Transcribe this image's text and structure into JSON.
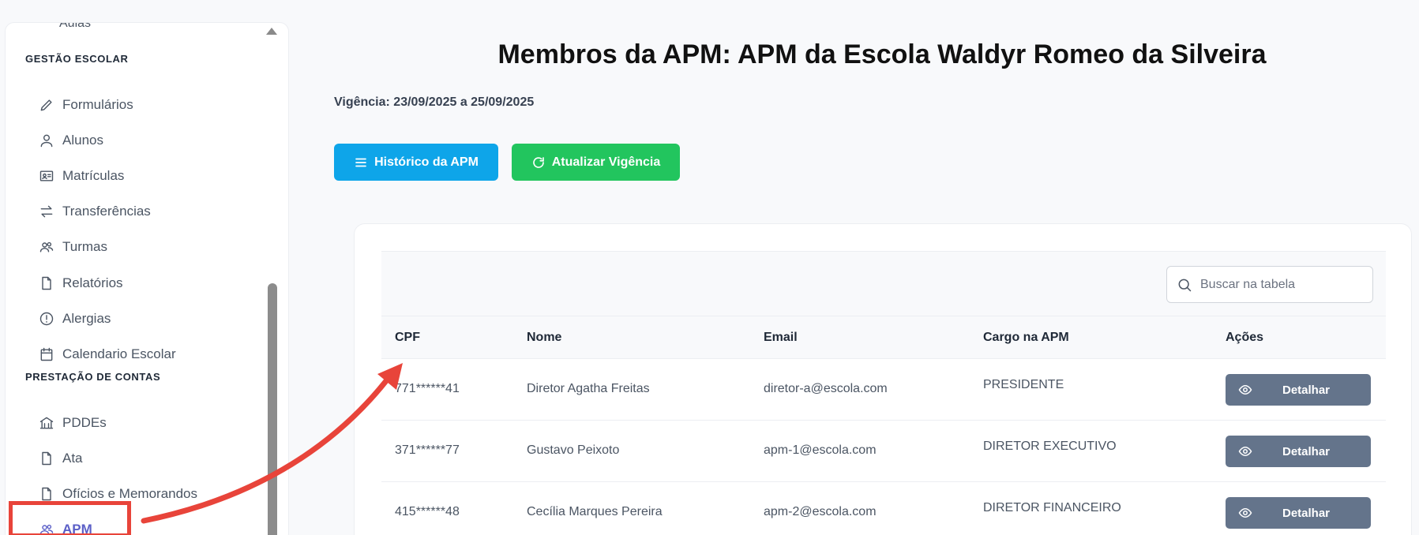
{
  "sidebar": {
    "top_item": "Aulas",
    "section_gestao": "GESTÃO ESCOLAR",
    "section_prestacao": "PRESTAÇÃO DE CONTAS",
    "items": [
      {
        "label": "Formulários",
        "icon": "pencil-icon"
      },
      {
        "label": "Alunos",
        "icon": "user-icon"
      },
      {
        "label": "Matrículas",
        "icon": "id-card-icon"
      },
      {
        "label": "Transferências",
        "icon": "transfer-arrows-icon"
      },
      {
        "label": "Turmas",
        "icon": "users-icon"
      },
      {
        "label": "Relatórios",
        "icon": "file-icon"
      },
      {
        "label": "Alergias",
        "icon": "alert-circle-icon"
      },
      {
        "label": "Calendario Escolar",
        "icon": "calendar-icon"
      },
      {
        "label": "PDDEs",
        "icon": "bank-icon"
      },
      {
        "label": "Ata",
        "icon": "file-icon"
      },
      {
        "label": "Ofícios e Memorandos",
        "icon": "file-icon"
      },
      {
        "label": "APM",
        "icon": "users-icon",
        "active": true
      }
    ]
  },
  "main": {
    "title": "Membros da APM: APM da Escola Waldyr Romeo da Silveira",
    "vigencia": "Vigência: 23/09/2025 a 25/09/2025",
    "btn_historico": "Histórico da APM",
    "btn_atualizar": "Atualizar Vigência",
    "search_placeholder": "Buscar na tabela",
    "columns": [
      "CPF",
      "Nome",
      "Email",
      "Cargo na APM",
      "Ações"
    ],
    "rows": [
      {
        "cpf": "771******41",
        "nome": "Diretor Agatha Freitas",
        "email": "diretor-a@escola.com",
        "cargo": "PRESIDENTE",
        "acao": "Detalhar"
      },
      {
        "cpf": "371******77",
        "nome": "Gustavo Peixoto",
        "email": "apm-1@escola.com",
        "cargo": "DIRETOR EXECUTIVO",
        "acao": "Detalhar"
      },
      {
        "cpf": "415******48",
        "nome": "Cecília Marques Pereira",
        "email": "apm-2@escola.com",
        "cargo": "DIRETOR FINANCEIRO",
        "acao": "Detalhar"
      }
    ]
  },
  "colors": {
    "accent_active": "#5b5fc7",
    "btn_historico": "#0ea5e9",
    "btn_atualizar": "#22c55e",
    "btn_detalhar": "#64748b",
    "annotation_red": "#e8443a"
  }
}
